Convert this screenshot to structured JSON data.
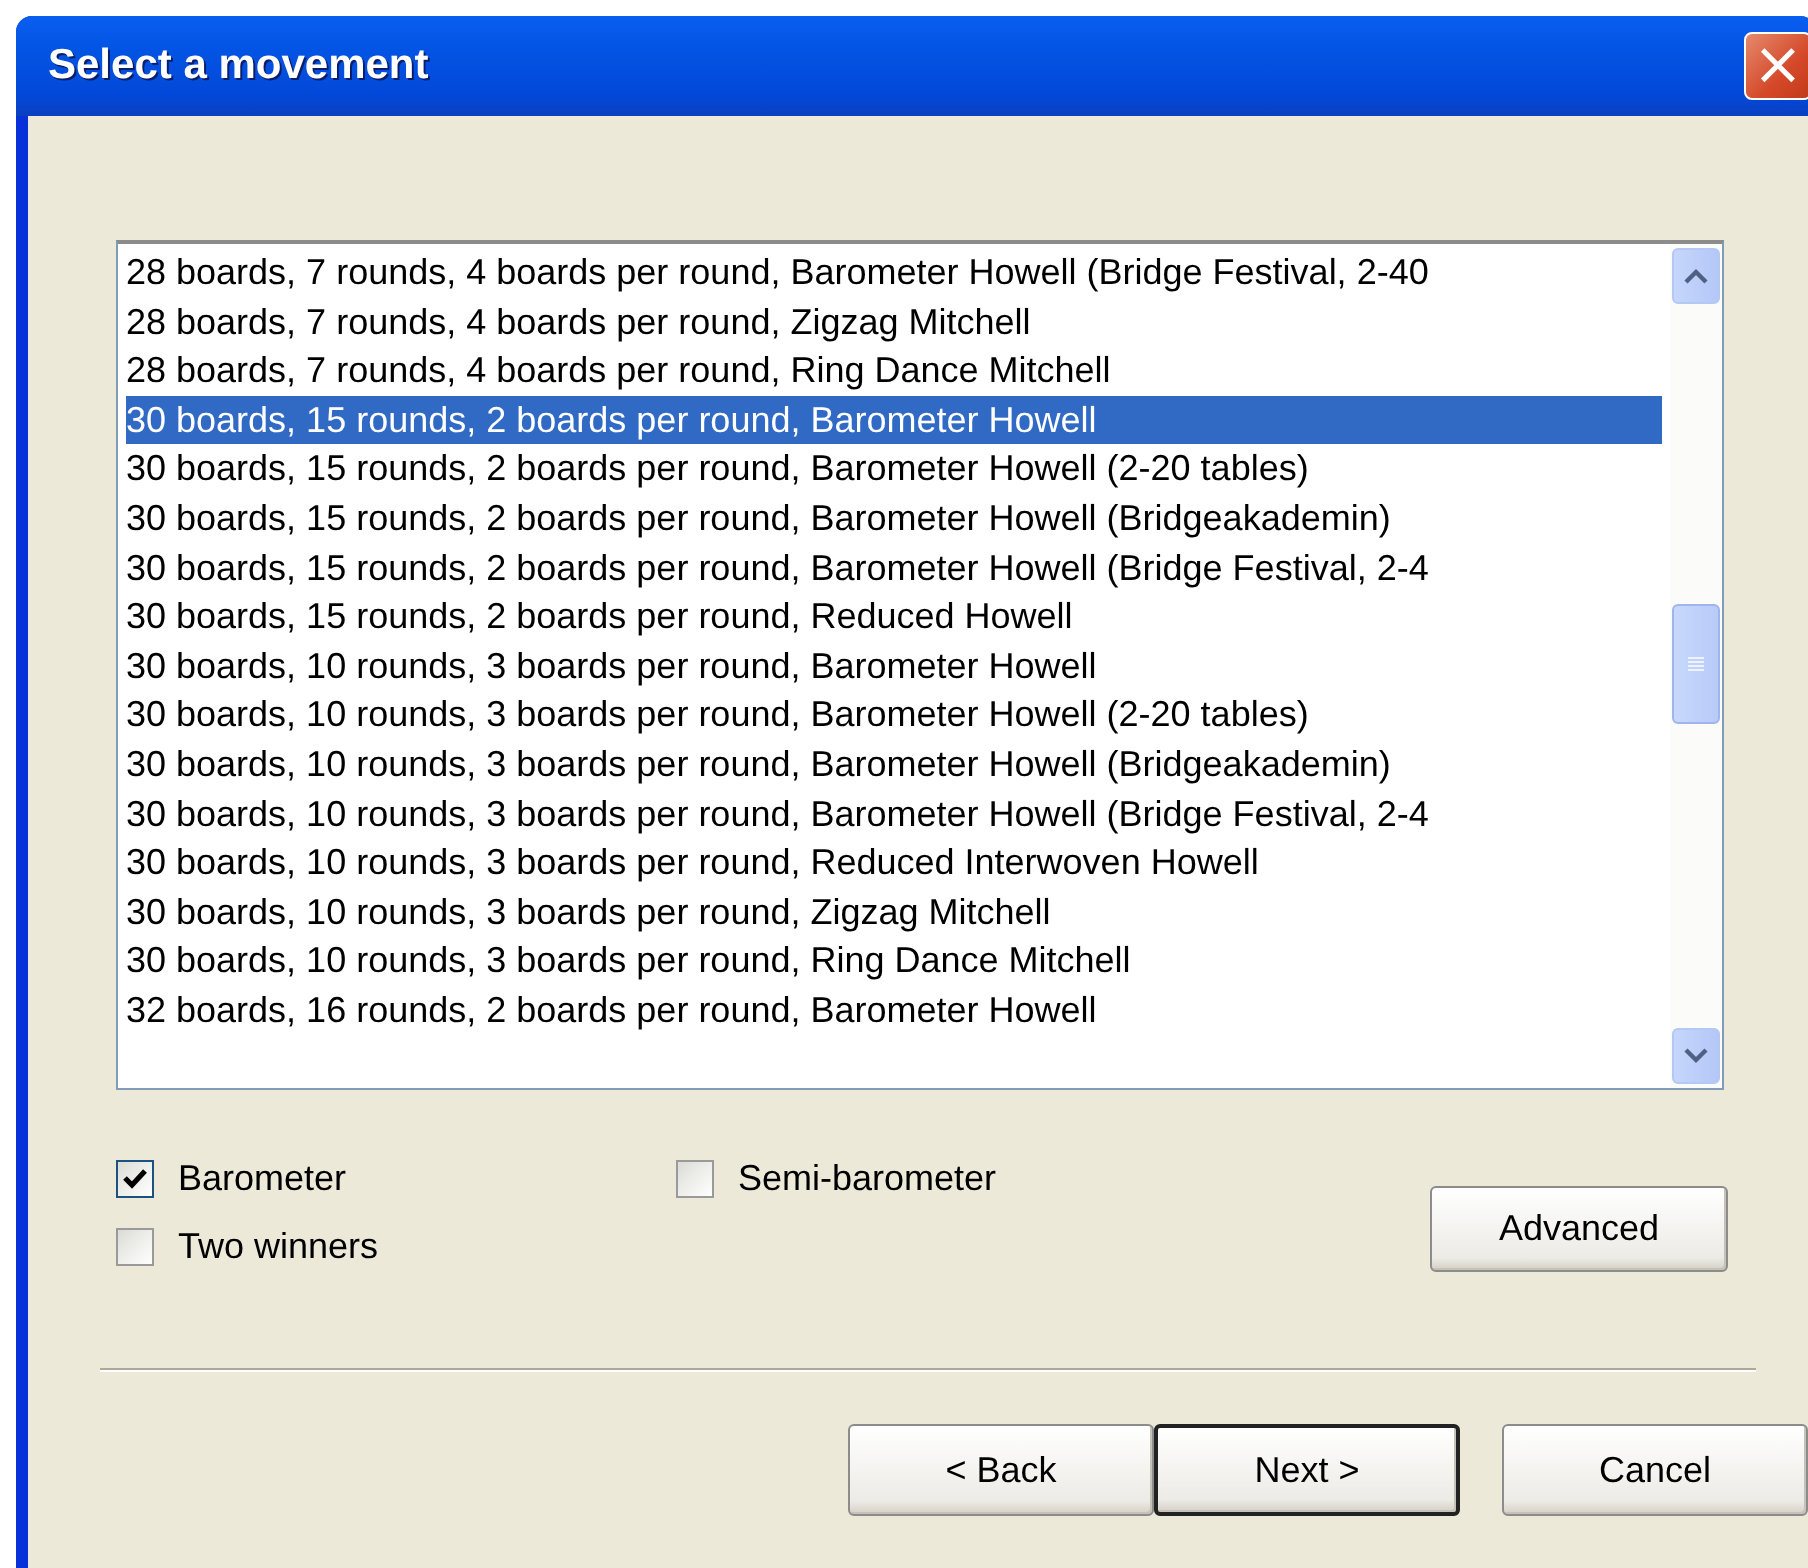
{
  "window": {
    "title": "Select a movement",
    "close": "×"
  },
  "movements": [
    {
      "label": "28 boards, 7 rounds, 4 boards per round, Barometer Howell (Bridge Festival, 2-40",
      "selected": false
    },
    {
      "label": "28 boards, 7 rounds, 4 boards per round, Zigzag Mitchell",
      "selected": false
    },
    {
      "label": "28 boards, 7 rounds, 4 boards per round, Ring Dance Mitchell",
      "selected": false
    },
    {
      "label": "30 boards, 15 rounds, 2 boards per round, Barometer Howell",
      "selected": true
    },
    {
      "label": "30 boards, 15 rounds, 2 boards per round, Barometer Howell (2-20 tables)",
      "selected": false
    },
    {
      "label": "30 boards, 15 rounds, 2 boards per round, Barometer Howell (Bridgeakademin)",
      "selected": false
    },
    {
      "label": "30 boards, 15 rounds, 2 boards per round, Barometer Howell (Bridge Festival, 2-4",
      "selected": false
    },
    {
      "label": "30 boards, 15 rounds, 2 boards per round, Reduced Howell",
      "selected": false
    },
    {
      "label": "30 boards, 10 rounds, 3 boards per round, Barometer Howell",
      "selected": false
    },
    {
      "label": "30 boards, 10 rounds, 3 boards per round, Barometer Howell (2-20 tables)",
      "selected": false
    },
    {
      "label": "30 boards, 10 rounds, 3 boards per round, Barometer Howell (Bridgeakademin)",
      "selected": false
    },
    {
      "label": "30 boards, 10 rounds, 3 boards per round, Barometer Howell (Bridge Festival, 2-4",
      "selected": false
    },
    {
      "label": "30 boards, 10 rounds, 3 boards per round, Reduced Interwoven Howell",
      "selected": false
    },
    {
      "label": "30 boards, 10 rounds, 3 boards per round, Zigzag Mitchell",
      "selected": false
    },
    {
      "label": "30 boards, 10 rounds, 3 boards per round, Ring Dance Mitchell",
      "selected": false
    },
    {
      "label": "32 boards, 16 rounds, 2 boards per round, Barometer Howell",
      "selected": false
    }
  ],
  "options": [
    {
      "label": "Barometer",
      "checked": true
    },
    {
      "label": "Semi-barometer",
      "checked": false
    },
    {
      "label": "Two winners",
      "checked": false
    }
  ],
  "advanced_button": "Advanced",
  "buttons": [
    {
      "label": "< Back",
      "default": false
    },
    {
      "label": "Next >",
      "default": true
    },
    {
      "label": "Cancel",
      "default": false
    }
  ]
}
